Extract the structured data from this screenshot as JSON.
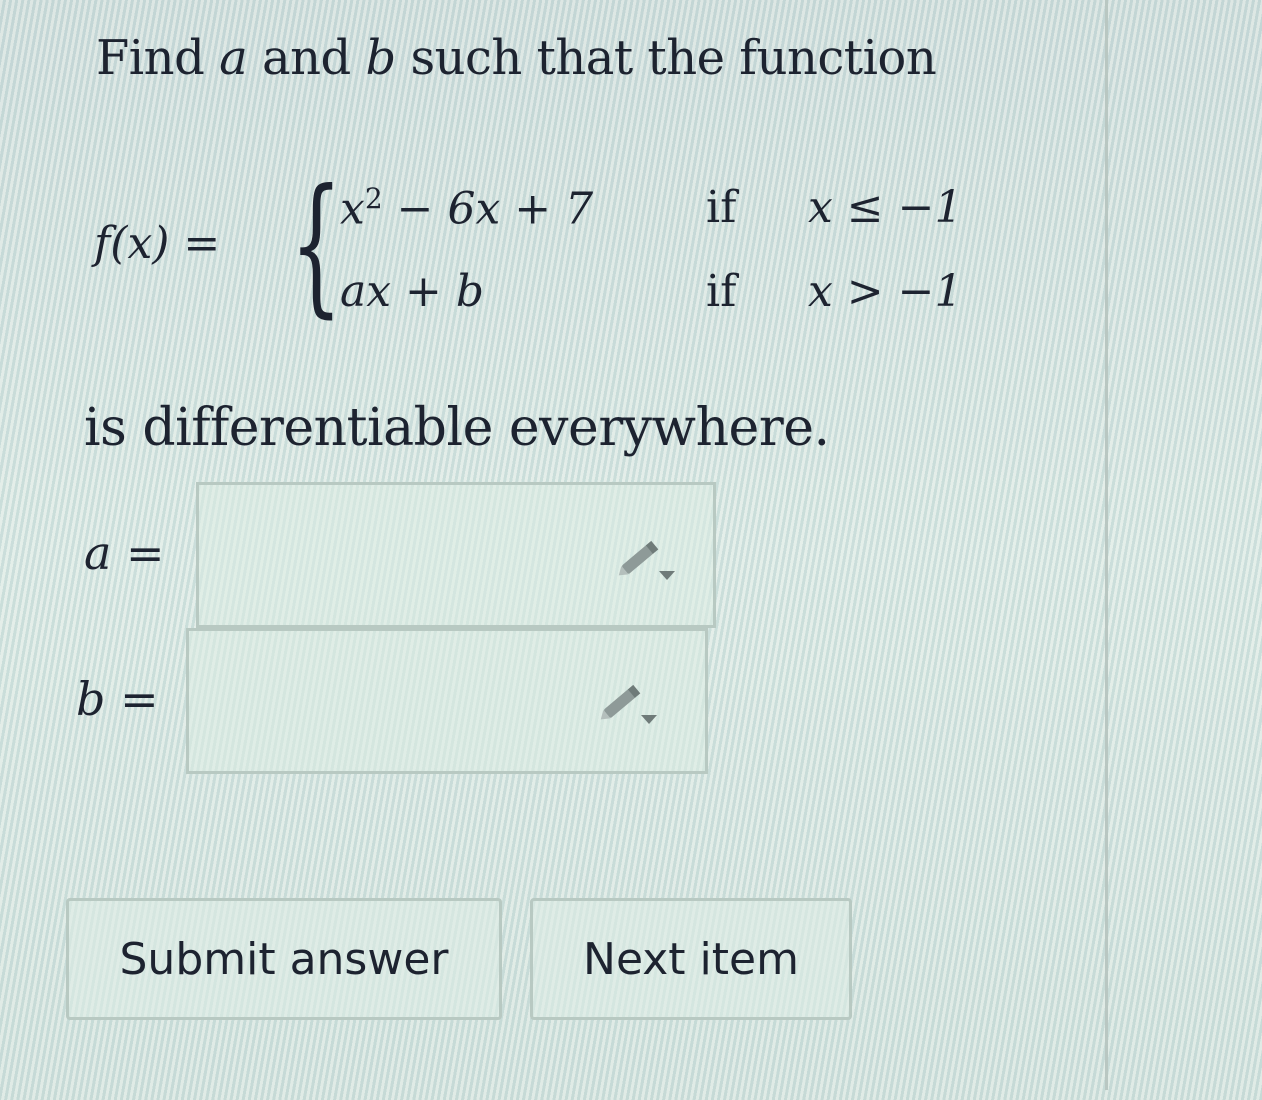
{
  "question": {
    "intro_prefix": "Find ",
    "intro_var_a": "a",
    "intro_mid": " and ",
    "intro_var_b": "b",
    "intro_suffix": " such that the function",
    "function_name": "f(x) =",
    "cases": [
      {
        "expression": "x",
        "exponent": "2",
        "expression_rest": " − 6x + 7",
        "keyword": "if",
        "condition": "x ≤ −1"
      },
      {
        "expression": "ax + b",
        "exponent": "",
        "expression_rest": "",
        "keyword": "if",
        "condition": "x > −1"
      }
    ],
    "conclusion": "is differentiable everywhere."
  },
  "answers": {
    "a_label": "a =",
    "b_label": "b =",
    "a_value": "",
    "b_value": ""
  },
  "icons": {
    "editor": "pencil-dropdown-icon"
  },
  "buttons": {
    "submit_label": "Submit answer",
    "next_label": "Next item"
  }
}
